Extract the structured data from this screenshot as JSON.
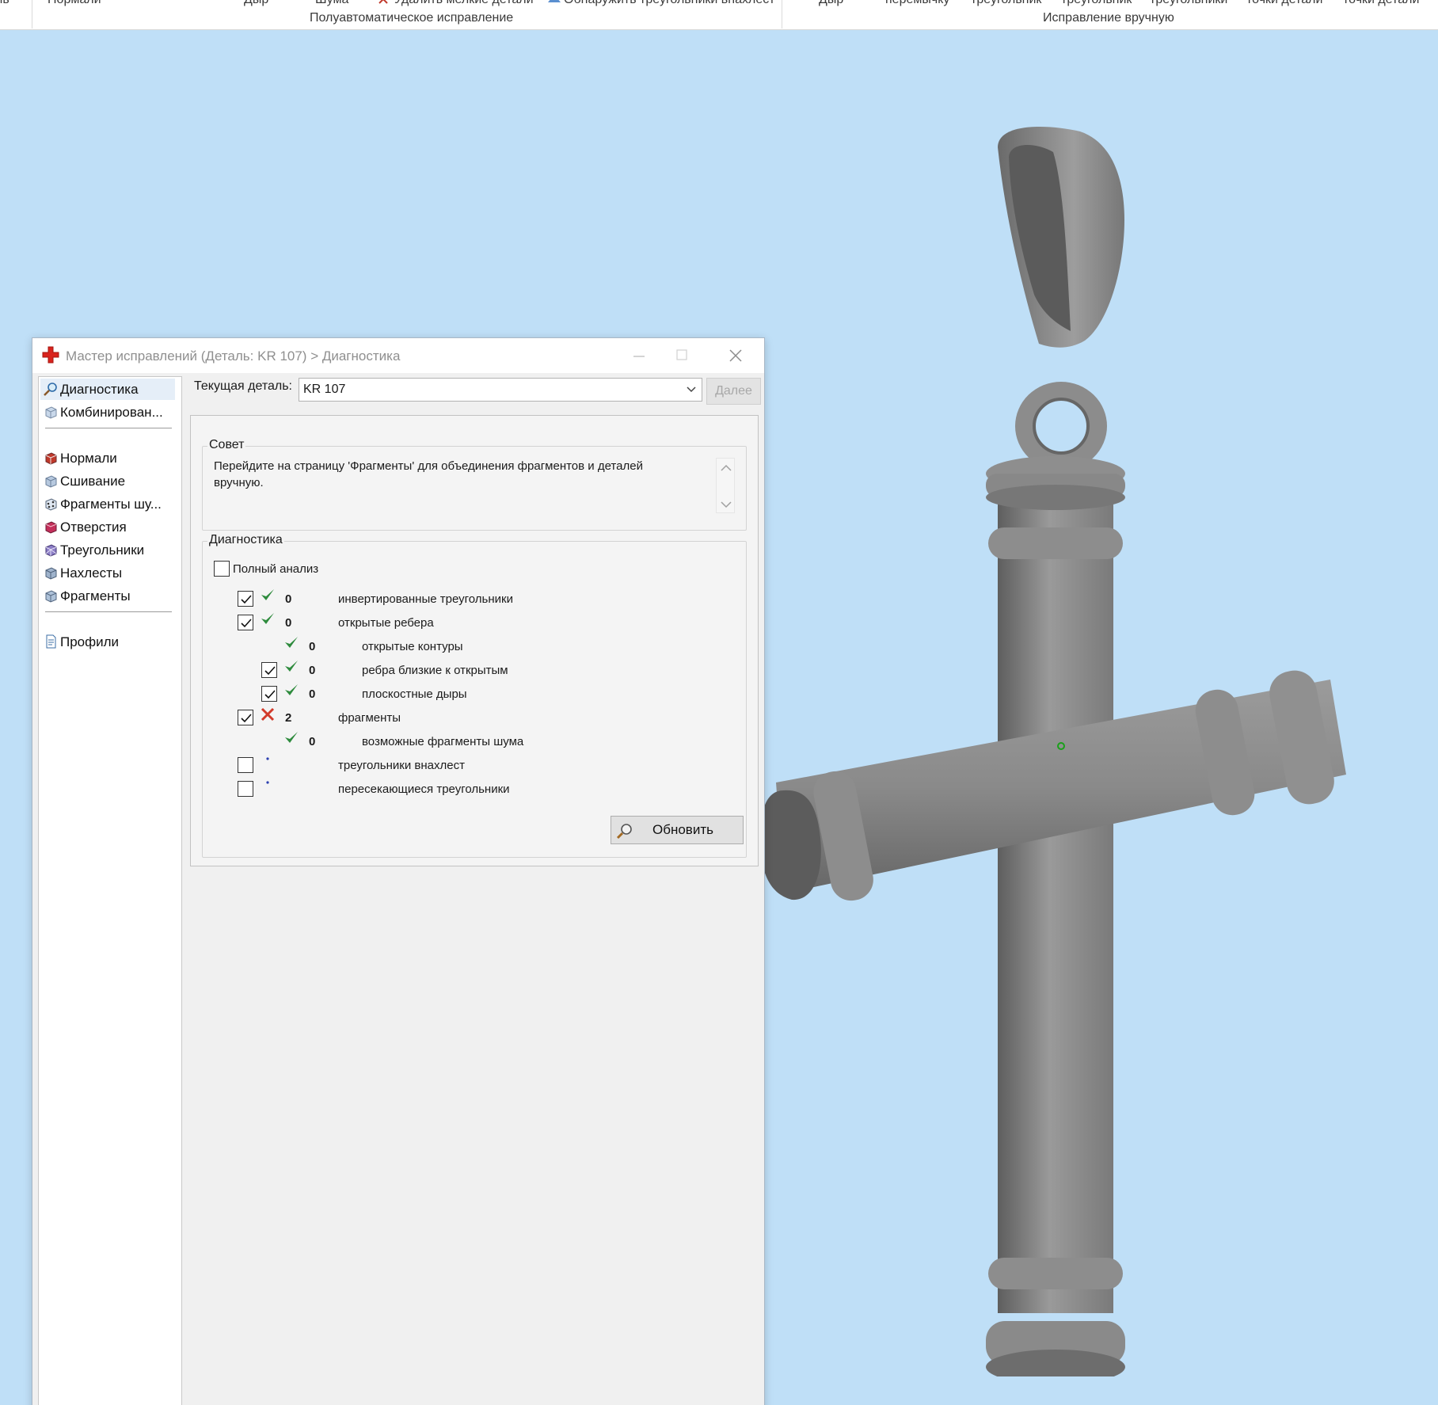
{
  "ribbon": {
    "cut_labels": [
      {
        "text": "Нормали"
      },
      {
        "text": "Дыр"
      },
      {
        "text": "Шума"
      },
      {
        "text": "Удалить мелкие детали"
      },
      {
        "text": "Обнаружить треугольники внахлест"
      },
      {
        "text": "Дыр"
      },
      {
        "text": "перемычку"
      },
      {
        "text": "треугольник"
      },
      {
        "text": "треугольник"
      },
      {
        "text": "треугольники"
      },
      {
        "text": "точки детали"
      },
      {
        "text": "точки детали"
      }
    ],
    "group_semi_auto": "Полуавтоматическое исправление",
    "group_manual": "Исправление вручную"
  },
  "dialog": {
    "title": "Мастер исправлений (Деталь: KR 107) > Диагностика",
    "nav": {
      "top": [
        {
          "label": "Диагностика",
          "icon": "magnifier-icon"
        },
        {
          "label": "Комбинирован...",
          "icon": "cube-icon"
        }
      ],
      "middle": [
        {
          "label": "Нормали",
          "icon": "normals-cube-icon"
        },
        {
          "label": "Сшивание",
          "icon": "stitch-cube-icon"
        },
        {
          "label": "Фрагменты шу...",
          "icon": "noise-dice-icon"
        },
        {
          "label": "Отверстия",
          "icon": "holes-cube-icon"
        },
        {
          "label": "Треугольники",
          "icon": "triangles-cube-icon"
        },
        {
          "label": "Нахлесты",
          "icon": "overlaps-cube-icon"
        },
        {
          "label": "Фрагменты",
          "icon": "shells-cube-icon"
        }
      ],
      "bottom": [
        {
          "label": "Профили",
          "icon": "document-icon"
        }
      ]
    },
    "current_part_label": "Текущая деталь:",
    "current_part_value": "KR 107",
    "next_button": "Далее",
    "tip": {
      "legend": "Совет",
      "text": "Перейдите на страницу 'Фрагменты' для объединения фрагментов и деталей вручную."
    },
    "diagnostics": {
      "legend": "Диагностика",
      "full_analysis_label": "Полный анализ",
      "full_analysis_checked": false,
      "rows": [
        {
          "checkbox": true,
          "checked": true,
          "status": "ok",
          "count": "0",
          "label": "инвертированные треугольники"
        },
        {
          "checkbox": true,
          "checked": true,
          "status": "ok",
          "count": "0",
          "label": "открытые ребера"
        },
        {
          "checkbox": false,
          "checked": false,
          "status": "ok",
          "count": "0",
          "label": "открытые контуры"
        },
        {
          "checkbox": true,
          "checked": true,
          "status": "ok",
          "count": "0",
          "label": "ребра близкие к открытым"
        },
        {
          "checkbox": true,
          "checked": true,
          "status": "ok",
          "count": "0",
          "label": "плоскостные дыры"
        },
        {
          "checkbox": true,
          "checked": true,
          "status": "fail",
          "count": "2",
          "label": "фрагменты"
        },
        {
          "checkbox": false,
          "checked": false,
          "status": "ok",
          "count": "0",
          "label": "возможные фрагменты шума"
        },
        {
          "checkbox": true,
          "checked": false,
          "status": "none",
          "count": "",
          "label": "треугольники внахлест"
        },
        {
          "checkbox": true,
          "checked": false,
          "status": "none",
          "count": "",
          "label": "пересекающиеся треугольники"
        }
      ],
      "refresh_button": "Обновить"
    }
  },
  "colors": {
    "viewport_bg": "#bfdff7",
    "ok_check": "#2e8b3d",
    "fail_cross": "#d23a2a",
    "model_gray": "#8a8a8a"
  }
}
